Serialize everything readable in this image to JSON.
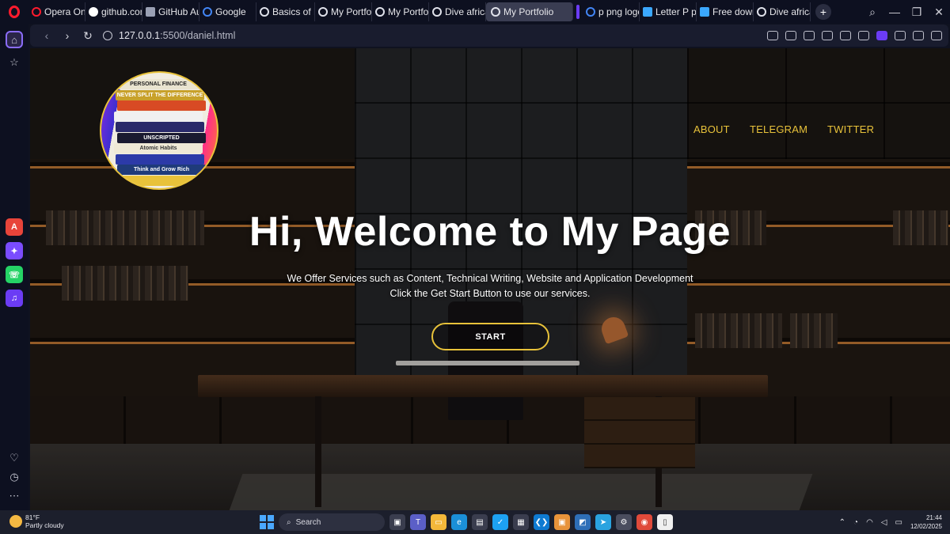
{
  "browser": {
    "tabs": [
      {
        "label": "Opera One",
        "icon": "opera-icon",
        "color": "#ff1b2d"
      },
      {
        "label": "github.com",
        "icon": "github-icon",
        "color": "#ffffff"
      },
      {
        "label": "GitHub Au",
        "icon": "file-icon",
        "color": "#9aa0b4"
      },
      {
        "label": "Google",
        "icon": "google-icon",
        "color": "#4285f4"
      },
      {
        "label": "Basics of P",
        "icon": "globe-icon",
        "color": "#dfe1ea"
      },
      {
        "label": "My Portfoli",
        "icon": "globe-icon",
        "color": "#dfe1ea"
      },
      {
        "label": "My Portfoli",
        "icon": "globe-icon",
        "color": "#dfe1ea"
      },
      {
        "label": "Dive africa",
        "icon": "globe-icon",
        "color": "#dfe1ea"
      },
      {
        "label": "My Portfolio",
        "icon": "globe-icon",
        "color": "#dfe1ea",
        "active": true
      },
      {
        "label": "p png logo",
        "icon": "google-icon",
        "color": "#4285f4"
      },
      {
        "label": "Letter P pn",
        "icon": "m-logo-icon",
        "color": "#3ba8ff"
      },
      {
        "label": "Free down",
        "icon": "m-logo-icon",
        "color": "#3ba8ff"
      },
      {
        "label": "Dive africa",
        "icon": "globe-icon",
        "color": "#dfe1ea"
      }
    ],
    "url_host": "127.0.0.1",
    "url_path": ":5500/daniel.html"
  },
  "page": {
    "nav": {
      "about": "ABOUT",
      "telegram": "TELEGRAM",
      "twitter": "TWITTER"
    },
    "title": "Hi, Welcome to My Page",
    "subtitle_1": "We Offer Services such as Content, Technical Writing, Website and Application Development",
    "subtitle_2": "Click the Get Start Button to use our services.",
    "start_label": "START",
    "avatar_books": [
      {
        "title": "PERSONAL FINANCE",
        "color": "#e9e4d0",
        "text": "#222222"
      },
      {
        "title": "NEVER SPLIT THE DIFFERENCE",
        "color": "#c8a12a",
        "text": "#ffffff"
      },
      {
        "title": "",
        "color": "#d84a24",
        "text": "#ffffff"
      },
      {
        "title": "",
        "color": "#f0f0f0",
        "text": "#333333"
      },
      {
        "title": "",
        "color": "#2a2a6a",
        "text": "#ffffff"
      },
      {
        "title": "UNSCRIPTED",
        "color": "#1a1a30",
        "text": "#ffffff"
      },
      {
        "title": "Atomic Habits",
        "color": "#efe9d6",
        "text": "#333333"
      },
      {
        "title": "",
        "color": "#2c3aa8",
        "text": "#ffffff"
      },
      {
        "title": "Think and Grow Rich",
        "color": "#1f3b7a",
        "text": "#ffffff"
      },
      {
        "title": "",
        "color": "#e8c23a",
        "text": "#222222"
      }
    ],
    "accent_color": "#e8c23a"
  },
  "taskbar": {
    "temperature": "81°F",
    "condition": "Partly cloudy",
    "search_label": "Search",
    "time": "21:44",
    "date": "12/02/2025",
    "apps": [
      "file-explorer-icon",
      "edge-icon",
      "store-icon",
      "twitter-icon",
      "vscode-icon",
      "app-icon",
      "telegram-icon",
      "settings-icon",
      "chrome-icon",
      "document-icon"
    ]
  }
}
